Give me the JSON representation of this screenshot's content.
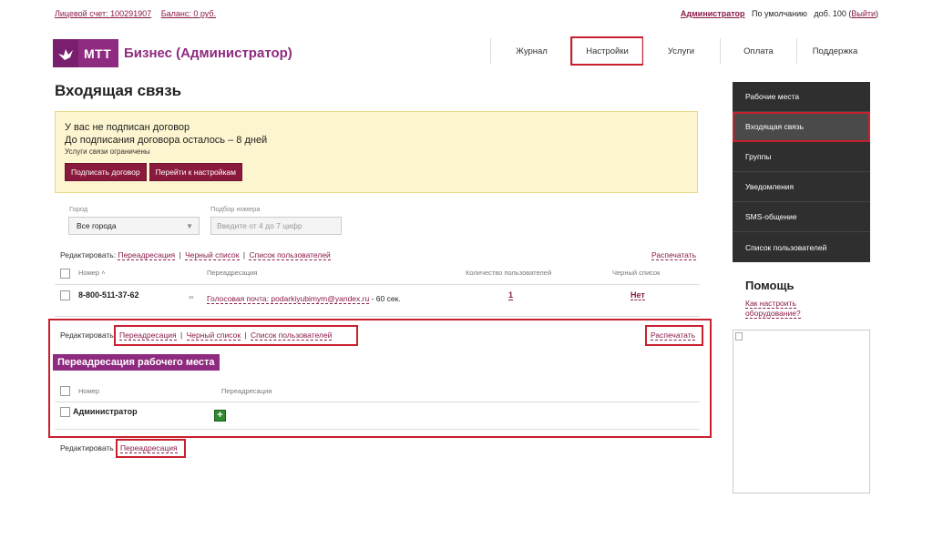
{
  "topbar": {
    "account": "Лицевой счет: 100291907",
    "balance": "Баланс: 0 руб.",
    "admin": "Администратор",
    "default": "По умолчанию",
    "ext_prefix": "доб. 100 (",
    "logout": "Выйти",
    "ext_suffix": ")"
  },
  "logo": {
    "brand": "МТТ",
    "title": "Бизнес (Администратор)"
  },
  "nav": [
    {
      "label": "Журнал"
    },
    {
      "label": "Настройки"
    },
    {
      "label": "Услуги"
    },
    {
      "label": "Оплата"
    },
    {
      "label": "Поддержка"
    }
  ],
  "page_title": "Входящая связь",
  "notice": {
    "line1": "У вас не подписан договор",
    "line2": "До подписания договора осталось – 8 дней",
    "line3": "Услуги связи ограничены",
    "btn_sign": "Подписать договор",
    "btn_settings": "Перейти к настройкам"
  },
  "filters": {
    "city_label": "Город",
    "city_value": "Все города",
    "number_label": "Подбор номера",
    "number_placeholder": "Введите от 4 до 7 цифр"
  },
  "edit": {
    "label": "Редактировать:",
    "label_short": "Редактировать",
    "redirect": "Переадресация",
    "blacklist": "Черный список",
    "users": "Список пользователей",
    "print": "Распечатать",
    "sep": "|"
  },
  "table1": {
    "headers": {
      "number": "Номер",
      "redirect": "Переадресация",
      "users_count": "Количество пользователей",
      "blacklist": "Черный список"
    },
    "row": {
      "number": "8-800-511-37-62",
      "redirect_text": "Голосовая почта: podarkiyubimym@yandex.ru",
      "redirect_suffix": "- 60 сек.",
      "users": "1",
      "blacklist": "Нет"
    }
  },
  "section2": {
    "title": "Переадресация рабочего места",
    "headers": {
      "number": "Номер",
      "redirect": "Переадресация"
    },
    "row": {
      "name": "Администратор",
      "add": "+"
    }
  },
  "sidebar": [
    {
      "label": "Рабочие места"
    },
    {
      "label": "Входящая связь"
    },
    {
      "label": "Группы"
    },
    {
      "label": "Уведомления"
    },
    {
      "label": "SMS-общение"
    },
    {
      "label": "Список пользователей"
    }
  ],
  "help": {
    "title": "Помощь",
    "link": "Как настроить оборудование?"
  },
  "icons": {
    "logo": "bird-logo-icon",
    "chevron": "chevron-down-icon",
    "voicemail": "voicemail-icon",
    "sort": "sort-up-icon",
    "plus": "plus-icon",
    "broken_image": "broken-image-icon"
  },
  "colors": {
    "brand": "#8e2a7f",
    "button": "#8a1a3d",
    "highlight": "#c8202e",
    "sidebar": "#2f2f2f",
    "notice": "#fdf5cf"
  }
}
